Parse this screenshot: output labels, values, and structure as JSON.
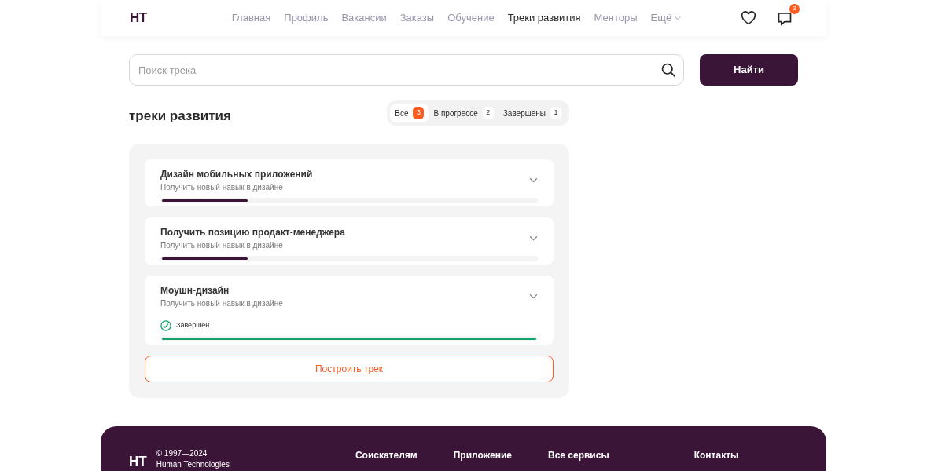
{
  "header": {
    "logo": "HT",
    "nav": [
      {
        "label": "Главная",
        "selected": false
      },
      {
        "label": "Профиль",
        "selected": false
      },
      {
        "label": "Вакансии",
        "selected": false
      },
      {
        "label": "Заказы",
        "selected": false
      },
      {
        "label": "Обучение",
        "selected": false
      },
      {
        "label": "Треки развития",
        "selected": true
      },
      {
        "label": "Менторы",
        "selected": false
      }
    ],
    "more": "Ещё",
    "messages_badge": "3"
  },
  "search": {
    "placeholder": "Поиск трека",
    "button": "Найти"
  },
  "section_title": "треки развития",
  "filters": [
    {
      "label": "Все",
      "count": "3",
      "selected": true
    },
    {
      "label": "В прогрессе",
      "count": "2",
      "selected": false
    },
    {
      "label": "Завершены",
      "count": "1",
      "selected": false
    }
  ],
  "tracks": [
    {
      "title": "Дизайн мобильных приложений",
      "subtitle": "Получить новый навык в дизайне",
      "completed": false,
      "level": 0.23
    },
    {
      "title": "Получить позицию продакт-менеджера",
      "subtitle": "Получить новый навык в дизайне",
      "completed": false,
      "level": 0.23
    },
    {
      "title": "Моушн-дизайн",
      "subtitle": "Получить новый навык в дизайне",
      "completed": true,
      "status": "Завершён",
      "level": 1
    }
  ],
  "build_button": "Построить трек",
  "footer": {
    "logo": "HT",
    "copyright": "© 1997—2024",
    "company": "Human Technologies",
    "columns": [
      "Соискателям",
      "Приложение",
      "Все сервисы",
      "Контакты"
    ]
  }
}
